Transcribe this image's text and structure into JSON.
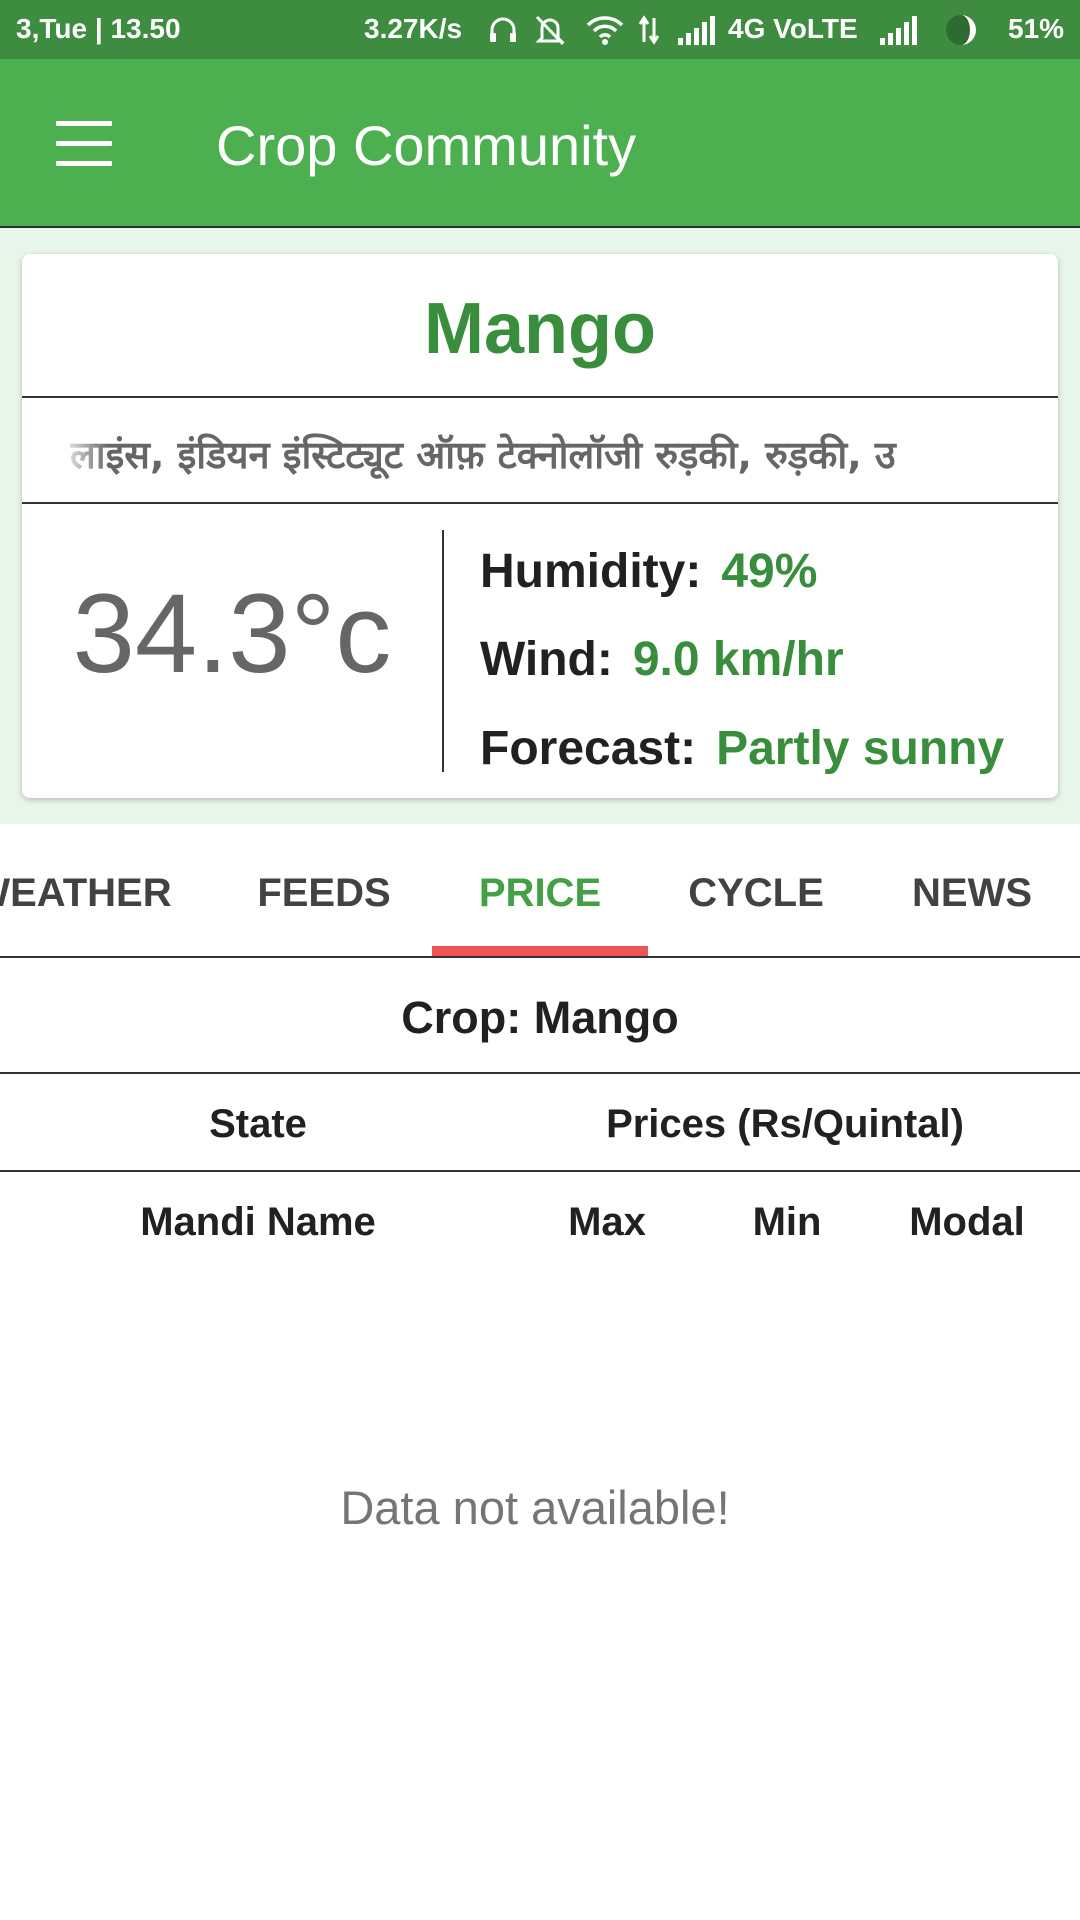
{
  "status_bar": {
    "time": "3,Tue | 13.50",
    "speed": "3.27K/s",
    "network": "4G VoLTE",
    "battery": "51%",
    "icons": [
      "headphones-icon",
      "mute-icon",
      "wifi-icon",
      "data-arrows-icon",
      "signal-icon",
      "signal-icon",
      "battery-icon"
    ]
  },
  "app_bar": {
    "title": "Crop Community",
    "menu_icon": "hamburger-menu-icon"
  },
  "weather_card": {
    "crop": "Mango",
    "location": "लाइंस, इंडियन इंस्टिट्यूट ऑफ़ टेक्नोलॉजी रुड़की, रुड़की, उ",
    "temperature": "34.3°c",
    "humidity_label": "Humidity:",
    "humidity_value": "49%",
    "wind_label": "Wind:",
    "wind_value": "9.0 km/hr",
    "forecast_label": "Forecast:",
    "forecast_value": "Partly sunny"
  },
  "tabs": [
    {
      "label": "WEATHER",
      "active": false
    },
    {
      "label": "FEEDS",
      "active": false
    },
    {
      "label": "PRICE",
      "active": true
    },
    {
      "label": "CYCLE",
      "active": false
    },
    {
      "label": "NEWS",
      "active": false
    }
  ],
  "price_table": {
    "crop_title": "Crop: Mango",
    "state_header": "State",
    "prices_header": "Prices (Rs/Quintal)",
    "columns": [
      "Mandi Name",
      "Max",
      "Min",
      "Modal"
    ],
    "rows": [],
    "empty_message": "Data not available!"
  },
  "colors": {
    "status_bar": "#3d8c40",
    "app_bar": "#4caf50",
    "accent_green": "#388e3c",
    "tab_indicator": "#f05555",
    "card_background": "#e8f5e9"
  }
}
